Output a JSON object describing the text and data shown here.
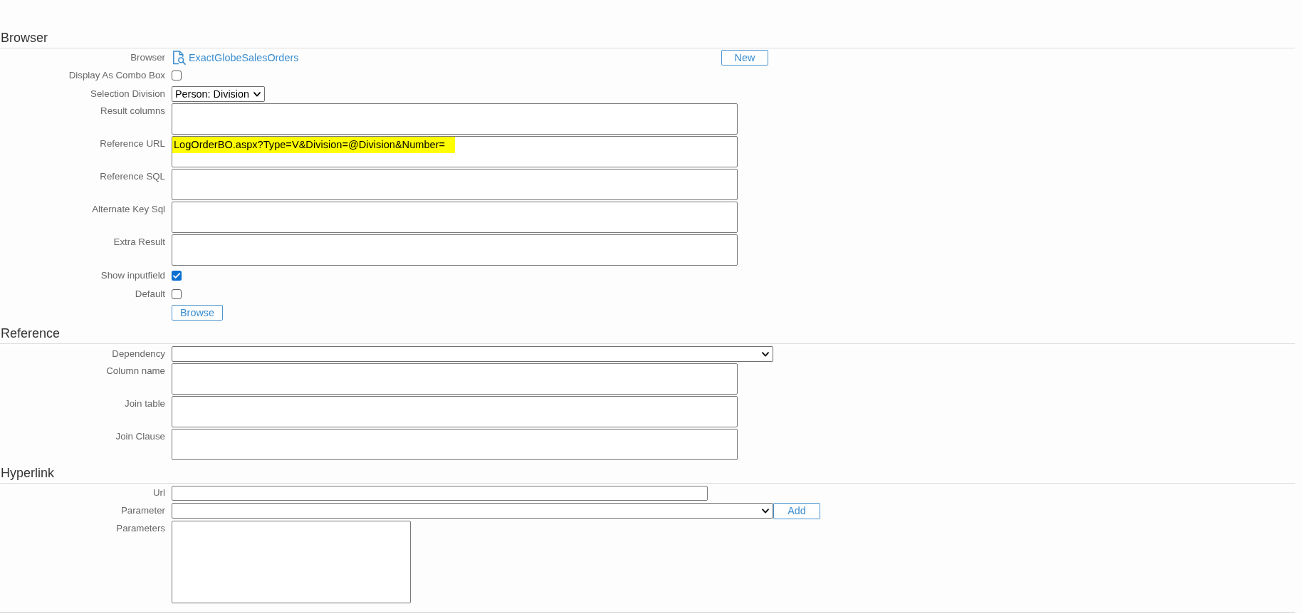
{
  "sections": [
    {
      "title": "Browser",
      "rows": [
        {
          "kind": "link",
          "label": "Browser",
          "value": "ExactGlobeSalesOrders",
          "button": "New"
        },
        {
          "kind": "checkbox",
          "label": "Display As Combo Box",
          "checked": false
        },
        {
          "kind": "select",
          "label": "Selection Division",
          "value": "Person: Division"
        },
        {
          "kind": "textarea",
          "label": "Result columns"
        },
        {
          "kind": "textarea",
          "label": "Reference URL",
          "value": "LogOrderBO.aspx?Type=V&Division=@Division&Number=",
          "highlighted": true
        },
        {
          "kind": "textarea",
          "label": "Reference SQL"
        },
        {
          "kind": "textarea",
          "label": "Alternate Key Sql"
        },
        {
          "kind": "textarea",
          "label": "Extra Result"
        },
        {
          "kind": "checkbox",
          "label": "Show inputfield",
          "checked": true
        },
        {
          "kind": "checkbox",
          "label": "Default",
          "checked": false
        },
        {
          "kind": "button",
          "text": "Browse"
        }
      ]
    },
    {
      "title": "Reference",
      "rows": [
        {
          "kind": "select",
          "label": "Dependency"
        },
        {
          "kind": "textarea",
          "label": "Column name"
        },
        {
          "kind": "textarea",
          "label": "Join table"
        },
        {
          "kind": "textarea",
          "label": "Join Clause"
        }
      ]
    },
    {
      "title": "Hyperlink",
      "rows": [
        {
          "kind": "input",
          "label": "Url"
        },
        {
          "kind": "select",
          "label": "Parameter",
          "button": "Add"
        },
        {
          "kind": "list",
          "label": "Parameters"
        }
      ]
    }
  ]
}
